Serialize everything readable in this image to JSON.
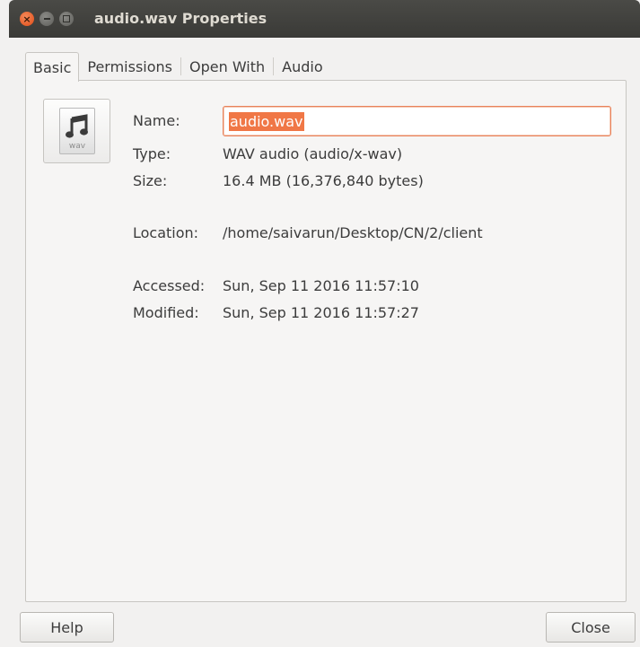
{
  "window": {
    "title": "audio.wav Properties",
    "close_glyph": "×"
  },
  "tabs": [
    {
      "label": "Basic",
      "active": true
    },
    {
      "label": "Permissions",
      "active": false
    },
    {
      "label": "Open With",
      "active": false
    },
    {
      "label": "Audio",
      "active": false
    }
  ],
  "file_icon": {
    "icon": "audio-music-note-icon",
    "ext_label": "wav"
  },
  "basic": {
    "name_label": "Name:",
    "name_value": "audio.wav",
    "type_label": "Type:",
    "type_value": "WAV audio (audio/x-wav)",
    "size_label": "Size:",
    "size_value": "16.4 MB (16,376,840 bytes)",
    "location_label": "Location:",
    "location_value": "/home/saivarun/Desktop/CN/2/client",
    "accessed_label": "Accessed:",
    "accessed_value": "Sun, Sep 11 2016 11:57:10",
    "modified_label": "Modified:",
    "modified_value": "Sun, Sep 11 2016 11:57:27"
  },
  "buttons": {
    "help": "Help",
    "close": "Close"
  },
  "colors": {
    "accent": "#f07746",
    "titlebar": "#3c3b37",
    "window_bg": "#f2f1f0"
  }
}
